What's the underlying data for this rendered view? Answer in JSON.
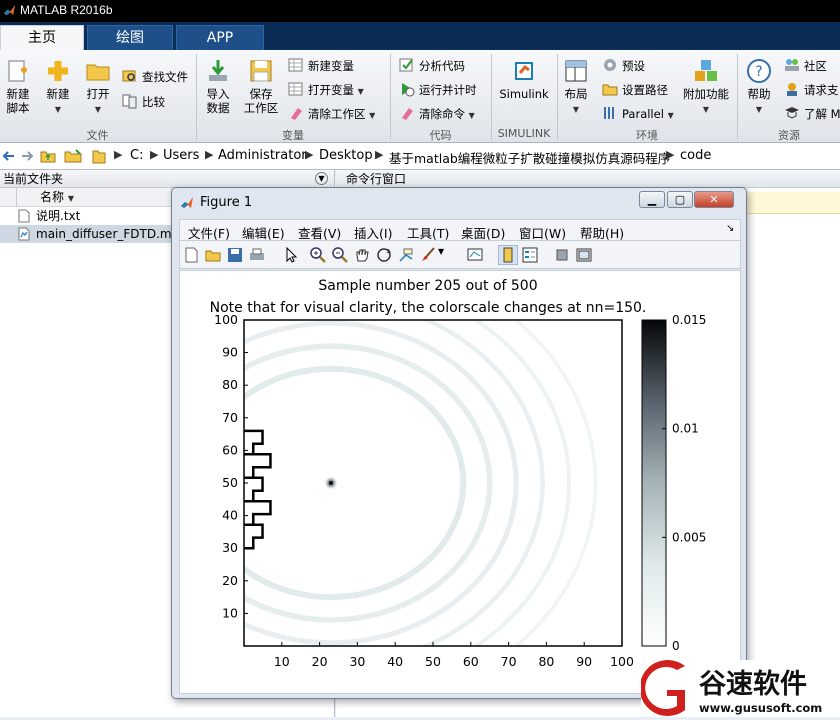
{
  "app": {
    "title": "MATLAB R2016b"
  },
  "tabs": [
    {
      "label": "主页",
      "active": true
    },
    {
      "label": "绘图",
      "active": false
    },
    {
      "label": "APP",
      "active": false
    }
  ],
  "ribbon": {
    "file": {
      "new_script": [
        "新建",
        "脚本"
      ],
      "new": "新建",
      "open": "打开",
      "find_files": "查找文件",
      "compare": "比较",
      "group_label": "文件"
    },
    "variable": {
      "import": [
        "导入",
        "数据"
      ],
      "save_workspace": [
        "保存",
        "工作区"
      ],
      "new_variable": "新建变量",
      "open_variable": "打开变量",
      "clear_workspace": "清除工作区",
      "group_label": "变量"
    },
    "code": {
      "analyze": "分析代码",
      "run_time": "运行并计时",
      "clear_commands": "清除命令",
      "group_label": "代码"
    },
    "simulink": {
      "button": "Simulink",
      "group_label": "SIMULINK"
    },
    "environment": {
      "layout": "布局",
      "preferences": "预设",
      "set_path": "设置路径",
      "parallel": "Parallel",
      "addons": "附加功能",
      "group_label": "环境"
    },
    "resources": {
      "help": "帮助",
      "community": "社区",
      "request_support": "请求支",
      "learn": "了解 M",
      "group_label": "资源"
    }
  },
  "address": {
    "segments": [
      "C:",
      "Users",
      "Administrator",
      "Desktop",
      "基于matlab编程微粒子扩散碰撞模拟仿真源码程序",
      "code"
    ]
  },
  "left_pane": {
    "title": "当前文件夹",
    "column_name": "名称",
    "files": [
      {
        "name": "说明.txt",
        "selected": false
      },
      {
        "name": "main_diffuser_FDTD.m",
        "selected": true
      }
    ]
  },
  "command_window": {
    "title": "命令行窗口"
  },
  "figure": {
    "title": "Figure 1",
    "menus": [
      "文件(F)",
      "编辑(E)",
      "查看(V)",
      "插入(I)",
      "工具(T)",
      "桌面(D)",
      "窗口(W)",
      "帮助(H)"
    ],
    "plot": {
      "title_line1": "Sample number 205 out of 500",
      "title_line2": "Note that for visual clarity, the colorscale changes at nn=150."
    }
  },
  "chart_data": {
    "type": "heatmap",
    "title": "Sample number 205 out of 500",
    "subtitle": "Note that for visual clarity, the colorscale changes at nn=150.",
    "xlim": [
      0,
      100
    ],
    "ylim": [
      0,
      100
    ],
    "xticks": [
      10,
      20,
      30,
      40,
      50,
      60,
      70,
      80,
      90,
      100
    ],
    "yticks": [
      10,
      20,
      30,
      40,
      50,
      60,
      70,
      80,
      90,
      100
    ],
    "colorbar": {
      "min": 0,
      "max": 0.015,
      "ticks": [
        0,
        0.005,
        0.01,
        0.015
      ],
      "tick_labels": [
        "0",
        "0.005",
        "0.01",
        "0.015"
      ]
    },
    "colormap": [
      "#ffffff",
      "#dfe9ea",
      "#a6b3b8",
      "#58626c",
      "#050608"
    ],
    "hotspot": {
      "x": 23,
      "y": 50,
      "value": 0.012
    },
    "wave_center": {
      "x": 23,
      "y": 50
    },
    "wave_radii": [
      35,
      42,
      49,
      56,
      63,
      70
    ],
    "diffuser_wall": {
      "x": 1,
      "ymin": 30,
      "ymax": 66
    }
  },
  "watermark": {
    "text": "谷速软件",
    "url": "www.gususoft.com",
    "color": "#d0201d"
  }
}
